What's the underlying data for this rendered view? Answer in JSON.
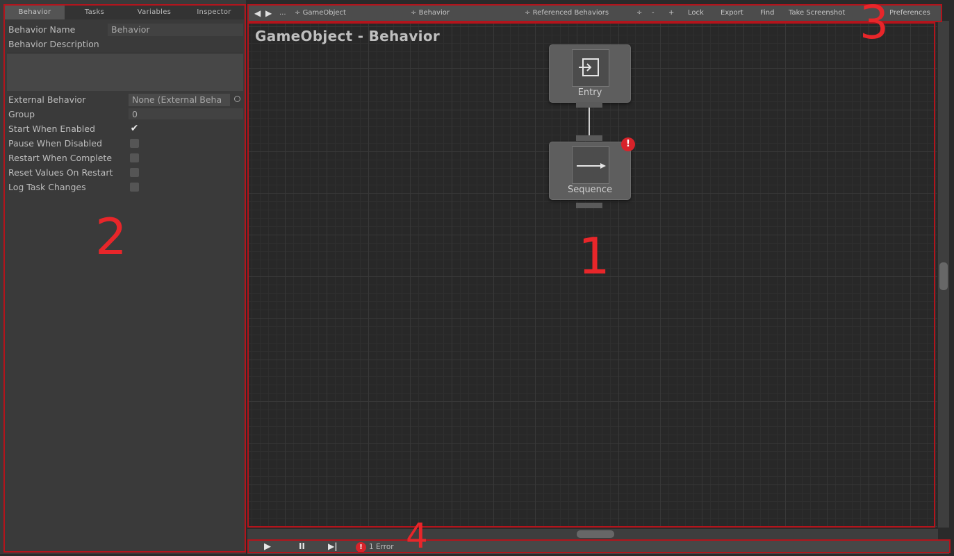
{
  "left_panel": {
    "tabs": [
      "Behavior",
      "Tasks",
      "Variables",
      "Inspector"
    ],
    "active_tab": "Behavior",
    "behavior_name_label": "Behavior Name",
    "behavior_name_value": "Behavior",
    "behavior_description_label": "Behavior Description",
    "external_behavior_label": "External Behavior",
    "external_behavior_value": "None (External Beha",
    "group_label": "Group",
    "group_value": "0",
    "options": [
      {
        "label": "Start When Enabled",
        "checked": true
      },
      {
        "label": "Pause When Disabled",
        "checked": false
      },
      {
        "label": "Restart When Complete",
        "checked": false
      },
      {
        "label": "Reset Values On Restart",
        "checked": false
      },
      {
        "label": "Log Task Changes",
        "checked": false
      }
    ],
    "check_mark": "✔"
  },
  "toolbar": {
    "back_icon": "◀",
    "forward_icon": "▶",
    "ellipsis": "...",
    "gameobject_select": "GameObject",
    "behavior_select": "Behavior",
    "referenced_select": "Referenced Behaviors",
    "select_marker": "÷",
    "minus": "-",
    "plus": "+",
    "lock": "Lock",
    "export": "Export",
    "find": "Find",
    "take_screenshot": "Take Screenshot",
    "preferences": "Preferences"
  },
  "graph": {
    "title": "GameObject - Behavior",
    "nodes": [
      {
        "label": "Entry",
        "icon": "entry-icon"
      },
      {
        "label": "Sequence",
        "icon": "sequence-arrow-icon",
        "error": true
      }
    ],
    "error_badge": "!"
  },
  "bottom_bar": {
    "play_icon": "▶",
    "pause_icon": "II",
    "step_icon": "▶|",
    "error_icon_text": "!",
    "error_count": "1 Error"
  },
  "annotations": [
    "1",
    "2",
    "3",
    "4"
  ],
  "colors": {
    "annotation_red": "#b3141c",
    "error_badge": "#d8232a"
  }
}
